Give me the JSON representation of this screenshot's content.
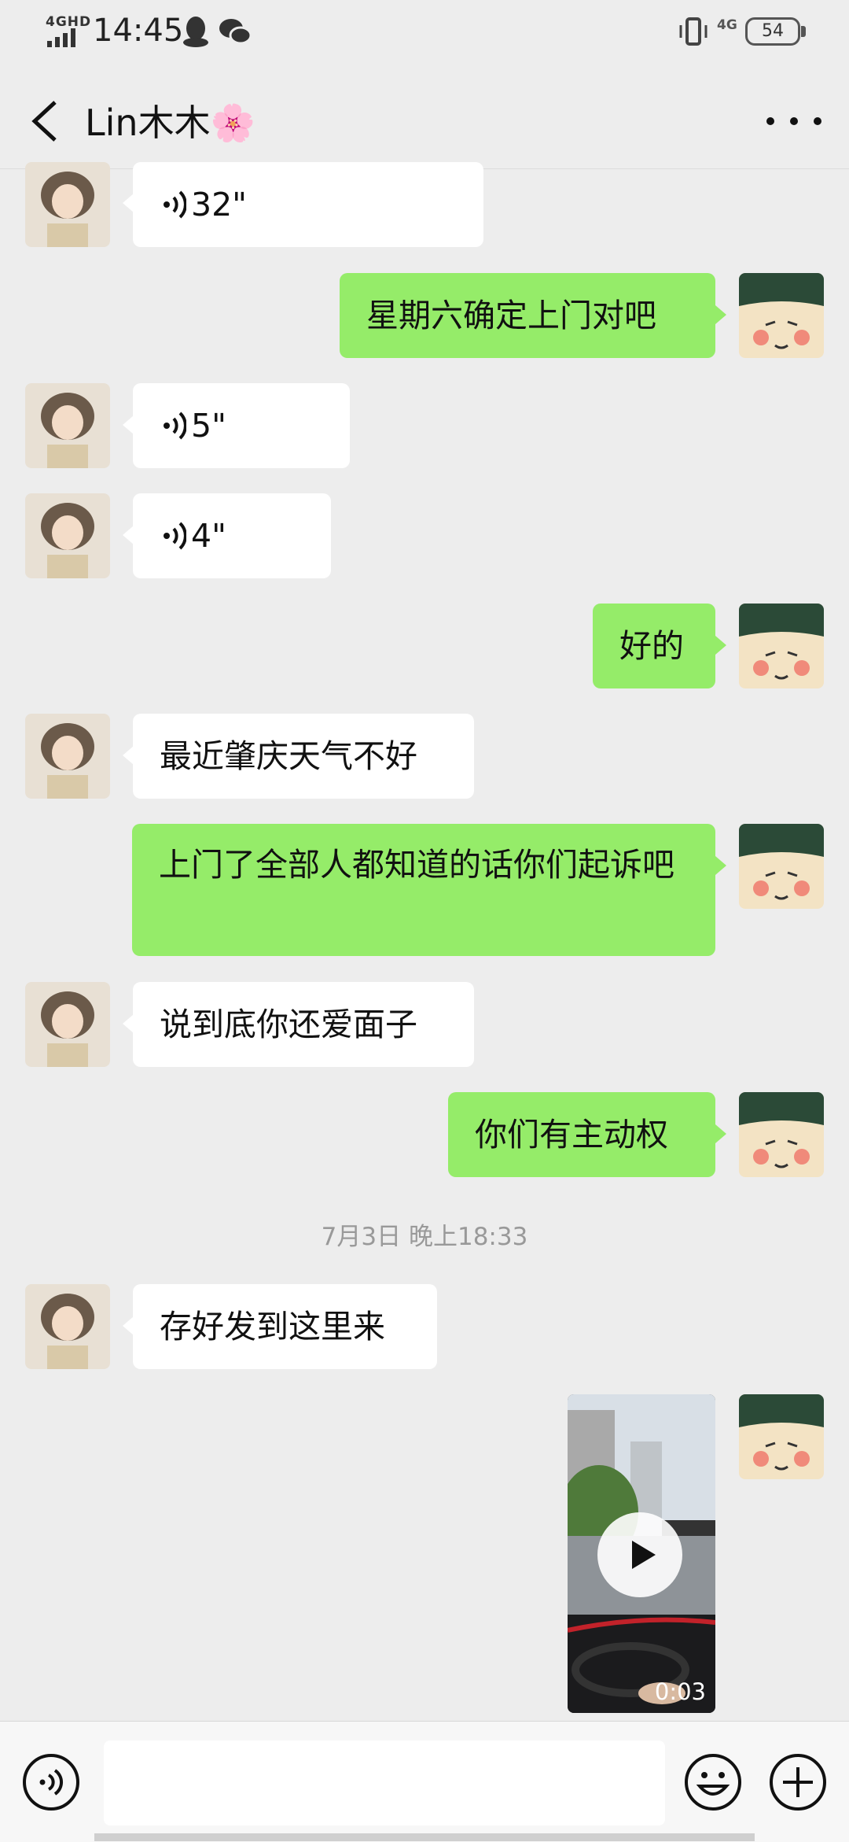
{
  "status_bar": {
    "network": "4GHD",
    "time": "14:45",
    "signal_right": "4G",
    "battery": "54"
  },
  "header": {
    "title": "Lin木木🌸"
  },
  "messages": [
    {
      "side": "left",
      "type": "voice",
      "text": "32\""
    },
    {
      "side": "right",
      "type": "text",
      "text": "星期六确定上门对吧"
    },
    {
      "side": "left",
      "type": "voice",
      "text": "5\""
    },
    {
      "side": "left",
      "type": "voice",
      "text": "4\""
    },
    {
      "side": "right",
      "type": "text",
      "text": "好的"
    },
    {
      "side": "left",
      "type": "text",
      "text": "最近肇庆天气不好"
    },
    {
      "side": "right",
      "type": "text",
      "text": "上门了全部人都知道的话你们起诉吧"
    },
    {
      "side": "left",
      "type": "text",
      "text": "说到底你还爱面子"
    },
    {
      "side": "right",
      "type": "text",
      "text": "你们有主动权"
    },
    {
      "side": "left",
      "type": "text",
      "text": "存好发到这里来"
    },
    {
      "side": "right",
      "type": "video",
      "duration": "0:03"
    }
  ],
  "timestamp": "7月3日 晚上18:33",
  "colors": {
    "sent": "#95ec69",
    "received": "#ffffff",
    "background": "#ededed"
  },
  "icons": [
    "back-icon",
    "more-icon",
    "voice-icon",
    "emoji-icon",
    "plus-icon",
    "play-icon"
  ]
}
